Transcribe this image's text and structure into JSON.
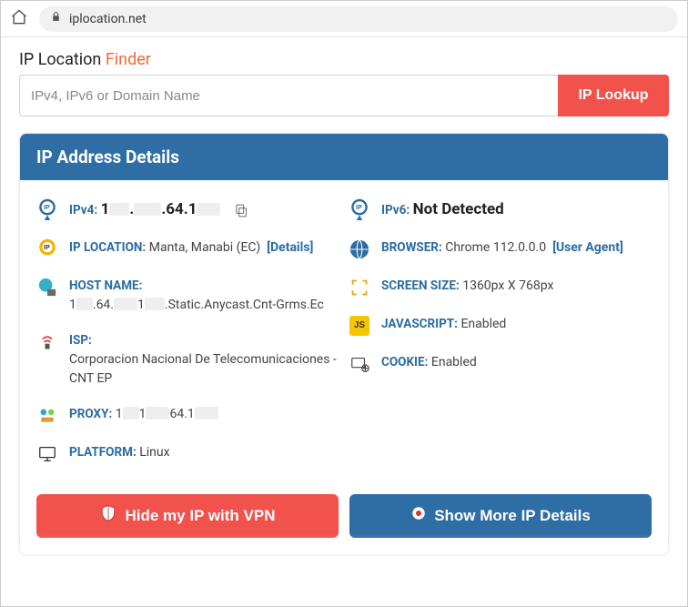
{
  "browser": {
    "url": "iplocation.net"
  },
  "heading": {
    "part1": "IP Location ",
    "part2": "Finder"
  },
  "search": {
    "placeholder": "IPv4, IPv6 or Domain Name",
    "button": "IP Lookup"
  },
  "card": {
    "title": "IP Address Details"
  },
  "left": {
    "ipv4": {
      "label": "IPv4:",
      "prefix": "1",
      "mid": ".64.1"
    },
    "location": {
      "label": "IP LOCATION:",
      "value": "Manta, Manabi (EC)",
      "details": "[Details]"
    },
    "host": {
      "label": "HOST NAME:",
      "value_prefix": "1",
      "value_mid": ".64.",
      "value_mid2": "1",
      "value_suffix": ".Static.Anycast.Cnt-Grms.Ec"
    },
    "isp": {
      "label": "ISP:",
      "value": "Corporacion Nacional De Telecomunicaciones - CNT EP"
    },
    "proxy": {
      "label": "PROXY:",
      "p1": "1",
      "p2": "1",
      "p3": "64.1"
    },
    "platform": {
      "label": "PLATFORM:",
      "value": "Linux"
    }
  },
  "right": {
    "ipv6": {
      "label": "IPv6:",
      "value": "Not Detected"
    },
    "browser": {
      "label": "BROWSER:",
      "value": "Chrome 112.0.0.0",
      "ua": "[User Agent]"
    },
    "screen": {
      "label": "SCREEN SIZE:",
      "value": "1360px X 768px"
    },
    "js": {
      "label": "JAVASCRIPT:",
      "value": "Enabled"
    },
    "cookie": {
      "label": "COOKIE:",
      "value": "Enabled"
    }
  },
  "buttons": {
    "hide": "Hide my IP with VPN",
    "more": "Show More IP Details"
  }
}
